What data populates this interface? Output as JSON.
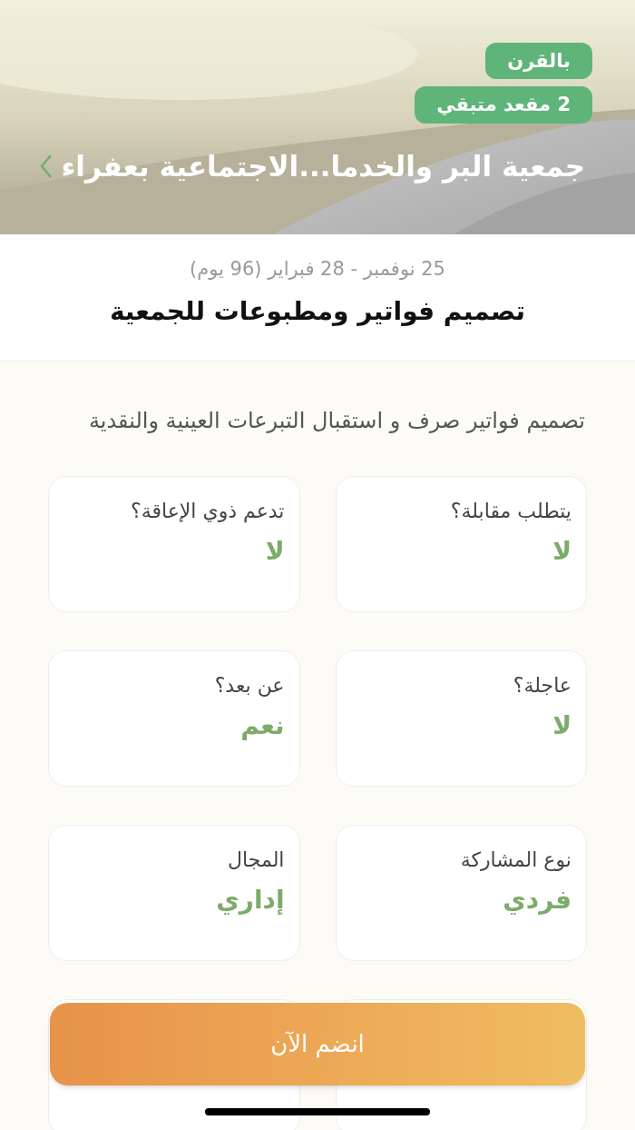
{
  "header": {
    "badges": [
      "بالقرن",
      "2 مقعد متبقي"
    ],
    "title": "جمعية البر والخدما...الاجتماعية بعفراء"
  },
  "date_range": "25 نوفمبر - 28 فبراير (96 يوم)",
  "task_title": "تصميم فواتير ومطبوعات للجمعية",
  "description": "تصميم فواتير  صرف و استقبال التبرعات العينية والنقدية",
  "fields": [
    {
      "label": "يتطلب مقابلة؟",
      "value": "لا"
    },
    {
      "label": "تدعم ذوي الإعاقة؟",
      "value": "لا"
    },
    {
      "label": "عاجلة؟",
      "value": "لا"
    },
    {
      "label": "عن بعد؟",
      "value": "نعم"
    },
    {
      "label": "نوع المشاركة",
      "value": "فردي"
    },
    {
      "label": "المجال",
      "value": "إداري"
    }
  ],
  "join_button": "انضم الآن"
}
